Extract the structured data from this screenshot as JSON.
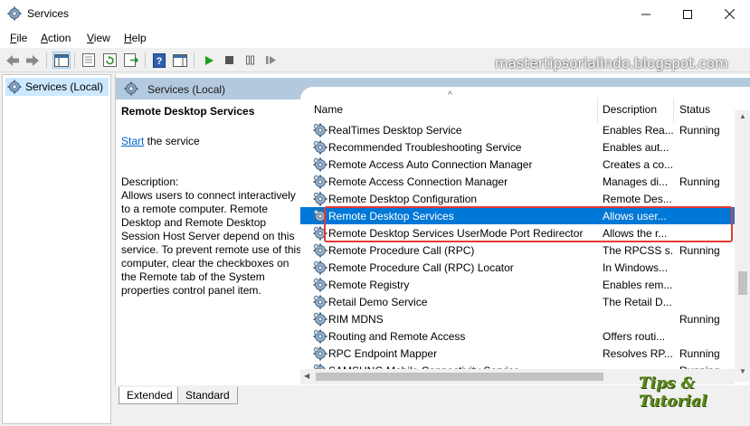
{
  "window": {
    "title": "Services",
    "controls": {
      "minimize": "—",
      "maximize": "☐",
      "close": "✕"
    }
  },
  "menu": [
    {
      "label": "File",
      "underline": "F",
      "rest": "ile"
    },
    {
      "label": "Action",
      "underline": "A",
      "rest": "ction"
    },
    {
      "label": "View",
      "underline": "V",
      "rest": "iew"
    },
    {
      "label": "Help",
      "underline": "H",
      "rest": "elp"
    }
  ],
  "toolbar": {
    "icons": [
      "back-arrow-icon",
      "forward-arrow-icon",
      "show-hide-console-tree-icon",
      "properties-icon",
      "refresh-icon",
      "export-list-icon",
      "help-icon",
      "show-hide-action-pane-icon",
      "start-service-icon",
      "stop-service-icon",
      "pause-service-icon",
      "restart-service-icon"
    ]
  },
  "watermark_top": "mastertipsorialindo.blogspot.com",
  "tree": {
    "root_label": "Services (Local)"
  },
  "pane_header": "Services (Local)",
  "details": {
    "service_name": "Remote Desktop Services",
    "action_link": "Start",
    "action_rest": " the service",
    "description_label": "Description:",
    "description_text": "Allows users to connect interactively to a remote computer. Remote Desktop and Remote Desktop Session Host Server depend on this service. To prevent remote use of this computer, clear the checkboxes on the Remote tab of the System properties control panel item."
  },
  "columns": {
    "name": "Name",
    "description": "Description",
    "status": "Status",
    "sort_indicator": "^"
  },
  "services": [
    {
      "name": "RealTimes Desktop Service",
      "description": "Enables Rea...",
      "status": "Running"
    },
    {
      "name": "Recommended Troubleshooting Service",
      "description": "Enables aut...",
      "status": ""
    },
    {
      "name": "Remote Access Auto Connection Manager",
      "description": "Creates a co...",
      "status": ""
    },
    {
      "name": "Remote Access Connection Manager",
      "description": "Manages di...",
      "status": "Running"
    },
    {
      "name": "Remote Desktop Configuration",
      "description": "Remote Des...",
      "status": ""
    },
    {
      "name": "Remote Desktop Services",
      "description": "Allows user...",
      "status": "",
      "selected": true
    },
    {
      "name": "Remote Desktop Services UserMode Port Redirector",
      "description": "Allows the r...",
      "status": ""
    },
    {
      "name": "Remote Procedure Call (RPC)",
      "description": "The RPCSS s...",
      "status": "Running"
    },
    {
      "name": "Remote Procedure Call (RPC) Locator",
      "description": "In Windows...",
      "status": ""
    },
    {
      "name": "Remote Registry",
      "description": "Enables rem...",
      "status": ""
    },
    {
      "name": "Retail Demo Service",
      "description": "The Retail D...",
      "status": ""
    },
    {
      "name": "RIM MDNS",
      "description": "",
      "status": "Running"
    },
    {
      "name": "Routing and Remote Access",
      "description": "Offers routi...",
      "status": ""
    },
    {
      "name": "RPC Endpoint Mapper",
      "description": "Resolves RP...",
      "status": "Running"
    },
    {
      "name": "SAMSUNG Mobile Connectivity Service",
      "description": "",
      "status": "Running"
    }
  ],
  "tabs": [
    {
      "label": "Extended",
      "active": true
    },
    {
      "label": "Standard",
      "active": false
    }
  ],
  "watermark_bottom": "Tips & Tutorial",
  "colors": {
    "selection": "#0078d7",
    "highlight_box": "#e53935",
    "header_bar": "#b3c9dd",
    "link": "#0066cc"
  }
}
